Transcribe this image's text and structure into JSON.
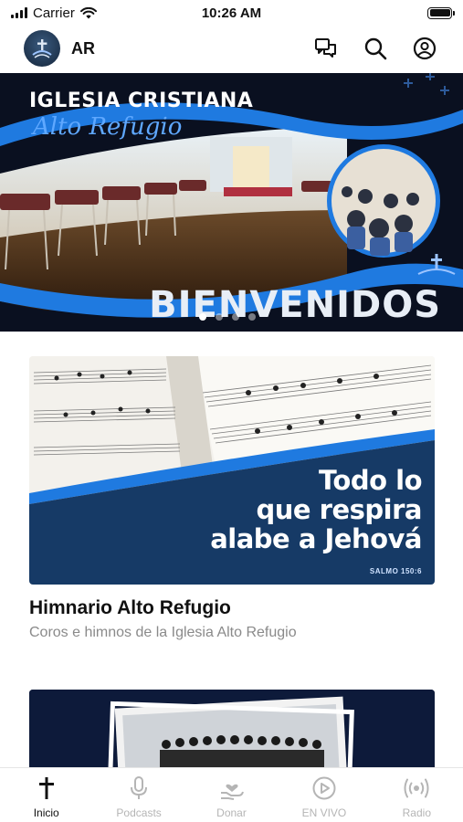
{
  "status_bar": {
    "carrier": "Carrier",
    "time": "10:26 AM",
    "wifi_icon": "wifi-icon",
    "battery_icon": "battery-icon"
  },
  "header": {
    "logo_icon": "church-logo",
    "title": "AR",
    "actions": [
      "chat-icon",
      "search-icon",
      "account-icon"
    ]
  },
  "banner": {
    "title": "IGLESIA CRISTIANA",
    "subtitle": "Alto Refugio",
    "welcome": "BIENVENIDOS",
    "slides_total": 4,
    "slide_active": 1
  },
  "cards": [
    {
      "title": "Himnario Alto Refugio",
      "subtitle": "Coros e himnos de la Iglesia Alto Refugio",
      "verse_lines": [
        "Todo lo",
        "que respira",
        "alabe a Jehová"
      ],
      "verse_ref": "SALMO 150:6"
    },
    {
      "title": "",
      "subtitle": ""
    }
  ],
  "tabbar": {
    "items": [
      {
        "label": "Inicio",
        "icon": "cross-icon",
        "active": true
      },
      {
        "label": "Podcasts",
        "icon": "microphone-icon",
        "active": false
      },
      {
        "label": "Donar",
        "icon": "donate-icon",
        "active": false
      },
      {
        "label": "EN VIVO",
        "icon": "play-circle-icon",
        "active": false
      },
      {
        "label": "Radio",
        "icon": "radio-icon",
        "active": false
      }
    ]
  },
  "colors": {
    "accent_blue": "#1f7ae0",
    "navy": "#163a66",
    "tab_inactive": "#b5b5b5",
    "tab_active": "#111111"
  }
}
